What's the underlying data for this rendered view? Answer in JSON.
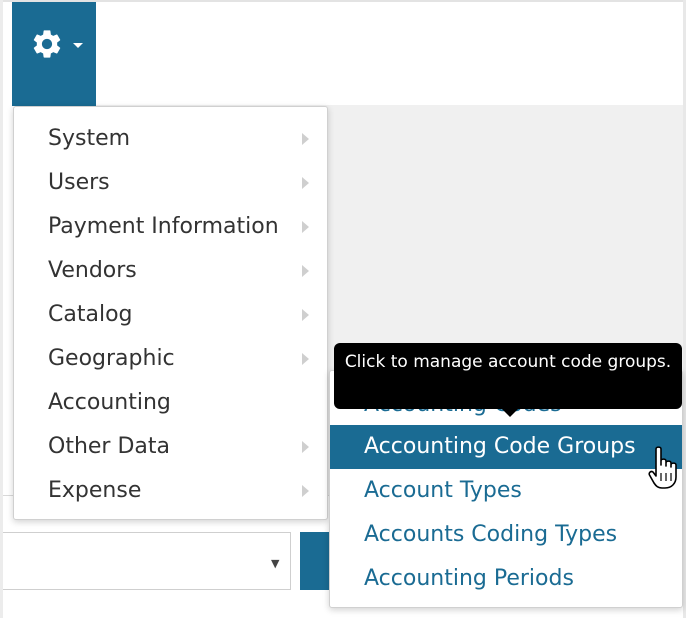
{
  "toolbar": {
    "settings_icon": "gear-icon",
    "dropdown_icon": "caret-down-icon",
    "accent_color": "#1a6b93"
  },
  "menu": {
    "items": [
      {
        "label": "System",
        "has_submenu": true
      },
      {
        "label": "Users",
        "has_submenu": true
      },
      {
        "label": "Payment Information",
        "has_submenu": true
      },
      {
        "label": "Vendors",
        "has_submenu": true
      },
      {
        "label": "Catalog",
        "has_submenu": true
      },
      {
        "label": "Geographic",
        "has_submenu": true
      },
      {
        "label": "Accounting",
        "has_submenu": false
      },
      {
        "label": "Other Data",
        "has_submenu": true
      },
      {
        "label": "Expense",
        "has_submenu": true
      }
    ]
  },
  "submenu": {
    "items": [
      {
        "label": "Accounting Codes"
      },
      {
        "label": "Accounting Code Groups",
        "active": true
      },
      {
        "label": "Account Types"
      },
      {
        "label": "Accounts Coding Types"
      },
      {
        "label": "Accounting Periods"
      }
    ]
  },
  "tooltip": {
    "text": "Click to manage account code groups."
  },
  "background": {
    "select_arrow": "▼"
  }
}
